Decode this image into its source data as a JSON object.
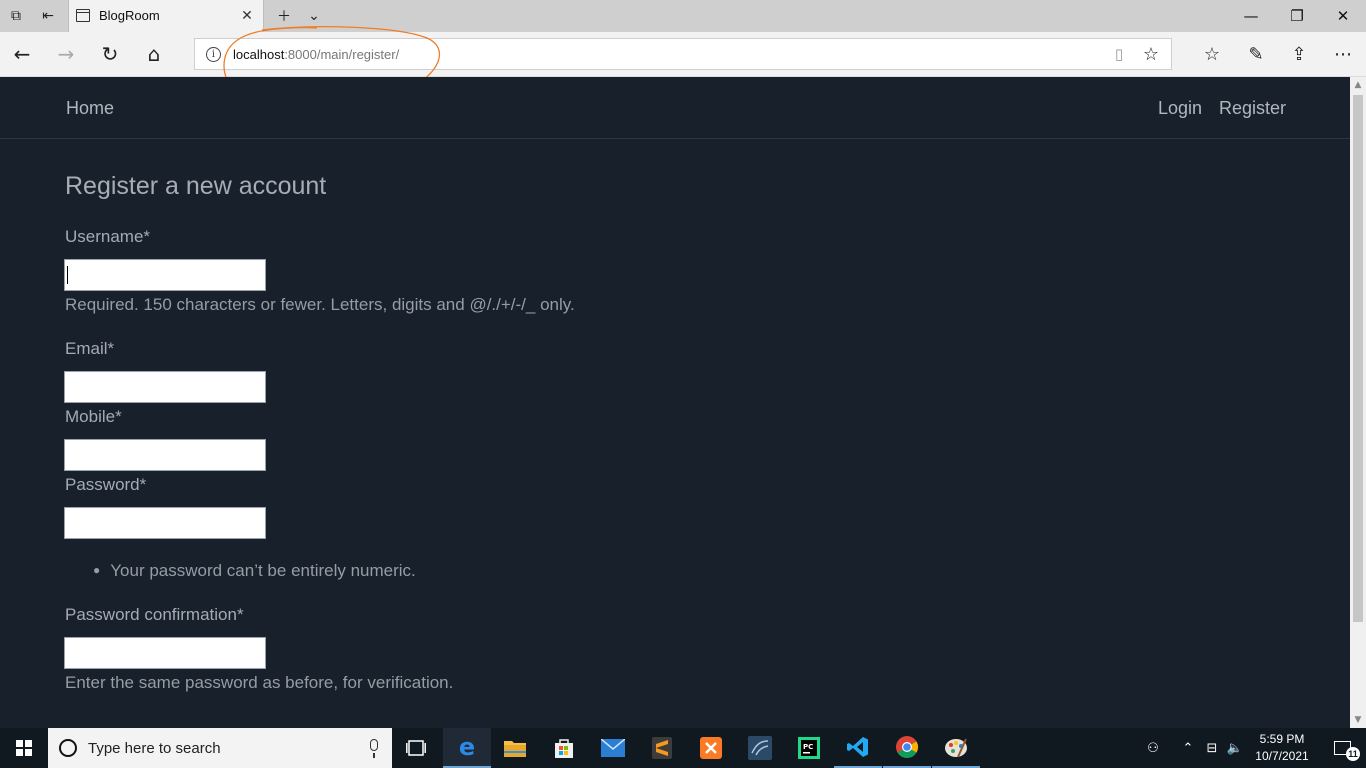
{
  "browser": {
    "tab_title": "BlogRoom",
    "url_host": "localhost",
    "url_rest": ":8000/main/register/",
    "annotation_color": "#f07d28"
  },
  "site": {
    "nav_home": "Home",
    "nav_login": "Login",
    "nav_register": "Register"
  },
  "form": {
    "title": "Register a new account",
    "username_label": "Username*",
    "username_help": "Required. 150 characters or fewer. Letters, digits and @/./+/-/_ only.",
    "email_label": "Email*",
    "mobile_label": "Mobile*",
    "password_label": "Password*",
    "password_rule": "Your password can’t be entirely numeric.",
    "confirm_label": "Password confirmation*",
    "confirm_help": "Enter the same password as before, for verification."
  },
  "taskbar": {
    "search_placeholder": "Type here to search",
    "time": "5:59 PM",
    "date": "10/7/2021",
    "notification_count": "11",
    "apps": [
      "edge-icon",
      "file-explorer-icon",
      "store-icon",
      "mail-icon",
      "sublime-text-icon",
      "xampp-icon",
      "mysql-workbench-icon",
      "pycharm-icon",
      "vscode-icon",
      "chrome-icon",
      "paint-icon"
    ]
  },
  "colors": {
    "page_bg": "#18202b",
    "text_muted": "#a4abb3",
    "taskbar_bg": "#101820",
    "chrome_bg": "#f2f2f2"
  }
}
